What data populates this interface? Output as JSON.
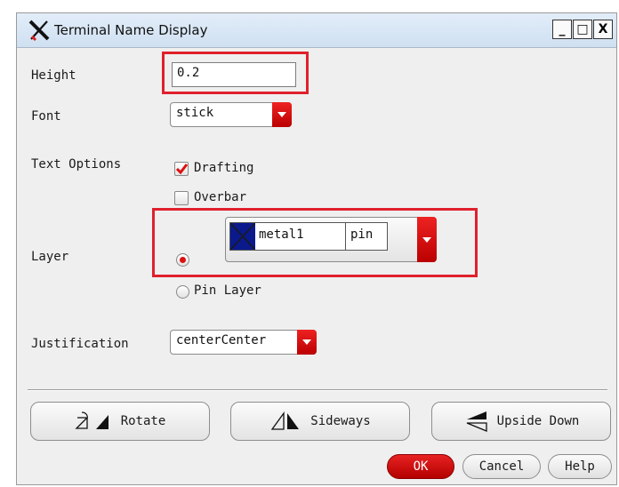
{
  "window": {
    "title": "Terminal Name Display",
    "controls": {
      "minimize": "_",
      "maximize": "□",
      "close": "X"
    }
  },
  "form": {
    "height": {
      "label": "Height",
      "value": "0.2"
    },
    "font": {
      "label": "Font",
      "value": "stick"
    },
    "text_options": {
      "label": "Text Options",
      "drafting": {
        "label": "Drafting",
        "checked": true
      },
      "overbar": {
        "label": "Overbar",
        "checked": false
      }
    },
    "layer": {
      "label": "Layer",
      "layer_name": "metal1",
      "purpose": "pin",
      "swatch_color": "#0a1a8c",
      "pin_layer_label": "Pin Layer"
    },
    "justification": {
      "label": "Justification",
      "value": "centerCenter"
    }
  },
  "actions": {
    "rotate": "Rotate",
    "sideways": "Sideways",
    "upside_down": "Upside Down"
  },
  "footer": {
    "ok": "OK",
    "cancel": "Cancel",
    "help": "Help"
  },
  "colors": {
    "highlight": "#e0202c",
    "accent_red": "#c80000"
  }
}
